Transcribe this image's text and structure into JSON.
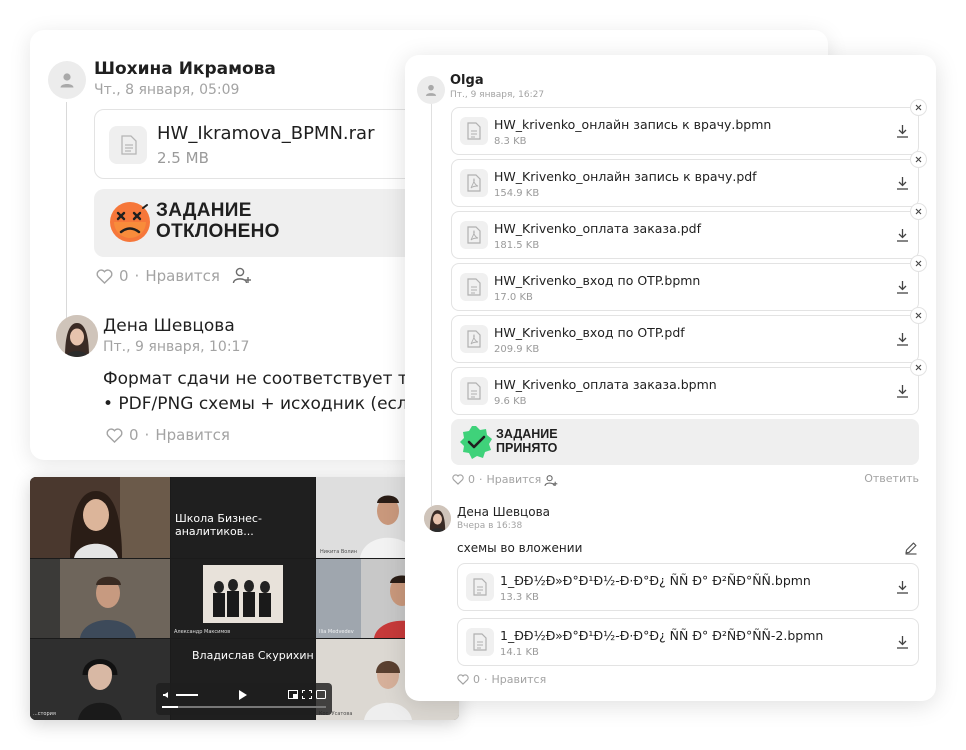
{
  "back_card": {
    "author1": {
      "name": "Шохина Икрамова",
      "date": "Чт., 8 января, 05:09"
    },
    "file": {
      "name": "HW_Ikramova_BPMN.rar",
      "size": "2.5 MB"
    },
    "status": {
      "line1": "ЗАДАНИЕ",
      "line2": "ОТКЛОНЕНО"
    },
    "likes1": {
      "count": "0",
      "label": "Нравится"
    },
    "author2": {
      "name": "Дена Шевцова",
      "date": "Пт., 9 января, 10:17"
    },
    "message": "Формат сдачи не соответствует т\n• PDF/PNG схемы + исходник (есл",
    "likes2": {
      "count": "0",
      "label": "Нравится"
    }
  },
  "video": {
    "title": "Школа Бизнес-аналитиков...",
    "speaker": "Владислав Скурихин",
    "participants": [
      "Никита Волин",
      "Александр Максимов",
      "Ilia Medvedev",
      "Кос. Усатова",
      "...стория"
    ]
  },
  "front_card": {
    "author": {
      "name": "Olga",
      "date": "Пт., 9 января, 16:27"
    },
    "files": [
      {
        "name": "HW_krivenko_онлайн запись к врачу.bpmn",
        "size": "8.3 KB",
        "kind": "doc"
      },
      {
        "name": "HW_Krivenko_онлайн запись к врачу.pdf",
        "size": "154.9 KB",
        "kind": "pdf"
      },
      {
        "name": "HW_Krivenko_оплата заказа.pdf",
        "size": "181.5 KB",
        "kind": "pdf"
      },
      {
        "name": "HW_Krivenko_вход по OTP.bpmn",
        "size": "17.0 KB",
        "kind": "doc"
      },
      {
        "name": "HW_Krivenko_вход по OTP.pdf",
        "size": "209.9 KB",
        "kind": "pdf"
      },
      {
        "name": "HW_Krivenko_оплата заказа.bpmn",
        "size": "9.6 KB",
        "kind": "doc"
      }
    ],
    "status": {
      "line1": "ЗАДАНИЕ",
      "line2": "ПРИНЯТО"
    },
    "likes": {
      "count": "0",
      "label": "Нравится"
    },
    "reply_label": "Ответить",
    "reply": {
      "author": {
        "name": "Дена Шевцова",
        "date": "Вчера в 16:38"
      },
      "message": "схемы во вложении",
      "files": [
        {
          "name": "1_ÐÐ½Ð»Ð°Ð¹Ð½-Ð·Ð°Ð¿ ÑÑ Ð° Ð²ÑÐ°ÑÑ.bpmn",
          "size": "13.3 KB"
        },
        {
          "name": "1_ÐÐ½Ð»Ð°Ð¹Ð½-Ð·Ð°Ð¿ ÑÑ Ð° Ð²ÑÐ°ÑÑ-2.bpmn",
          "size": "14.1 KB"
        }
      ],
      "likes": {
        "count": "0",
        "label": "Нравится"
      }
    }
  },
  "colors": {
    "accept_green": "#3fd27a",
    "reject_orange": "#f6773a",
    "muted": "#a3a3a3"
  }
}
